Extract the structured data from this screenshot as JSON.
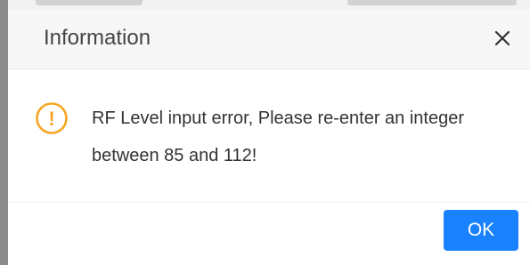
{
  "dialog": {
    "title": "Information",
    "close_icon": "close-icon",
    "warning_icon": "exclamation-circle-icon",
    "warning_glyph": "!",
    "message": "RF Level input error, Please re-enter an integer between 85 and 112!",
    "ok_label": "OK"
  },
  "colors": {
    "accent": "#1a82ff",
    "warning": "#f5a623",
    "title_text": "#444444",
    "body_text": "#333333"
  }
}
